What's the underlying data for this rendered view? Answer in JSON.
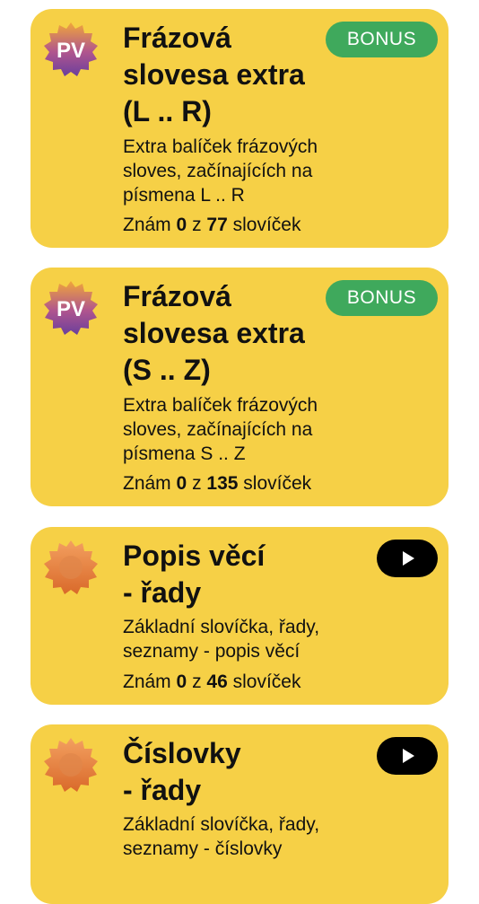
{
  "cards": [
    {
      "icon": "pv-sun-badge-icon",
      "icon_text": "PV",
      "title": "Frázová\nslovesa extra\n(L .. R)",
      "description": "Extra balíček frázových\nsloves, začínajících na\npísmena L .. R",
      "count_prefix": "Znám",
      "known": "0",
      "count_mid": "z",
      "total": "77",
      "count_suffix": "slovíček",
      "action_label": "BONUS"
    },
    {
      "icon": "pv-sun-badge-icon",
      "icon_text": "PV",
      "title": "Frázová\nslovesa extra\n(S .. Z)",
      "description": "Extra balíček frázových\nsloves, začínajících na\npísmena S .. Z",
      "count_prefix": "Znám",
      "known": "0",
      "count_mid": "z",
      "total": "135",
      "count_suffix": "slovíček",
      "action_label": "BONUS"
    },
    {
      "icon": "orange-sun-badge-icon",
      "title": "Popis věcí\n- řady",
      "description": "Základní slovíčka, řady,\nseznamy - popis věcí",
      "count_prefix": "Znám",
      "known": "0",
      "count_mid": "z",
      "total": "46",
      "count_suffix": "slovíček",
      "action": "play-icon"
    },
    {
      "icon": "orange-sun-badge-icon",
      "title": "Číslovky\n- řady",
      "description": "Základní slovíčka, řady,\nseznamy - číslovky",
      "action": "play-icon"
    }
  ],
  "colors": {
    "card_background": "#f6d046",
    "bonus_green": "#3fa95c",
    "play_black": "#000000"
  }
}
